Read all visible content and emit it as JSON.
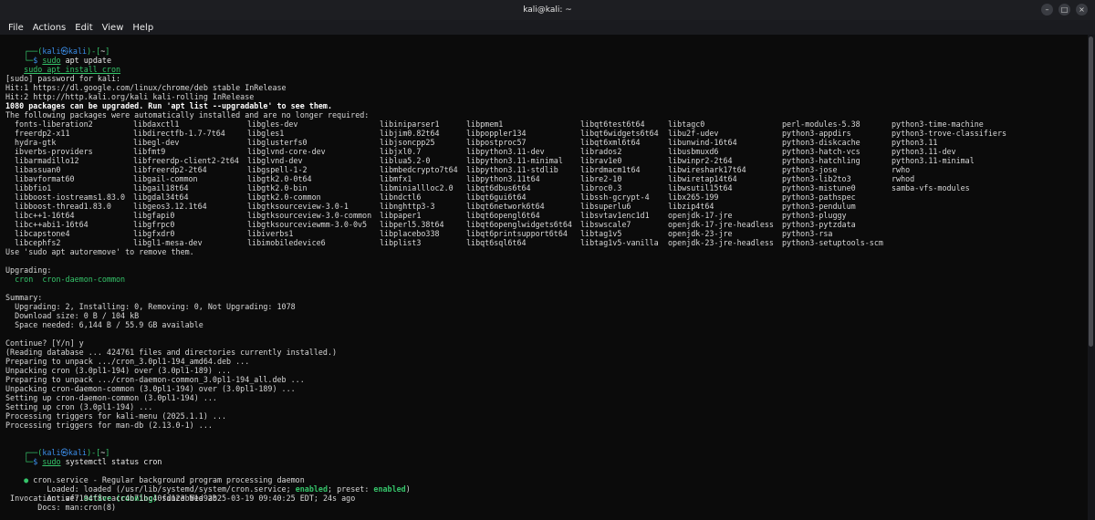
{
  "window": {
    "title": "kali@kali: ~",
    "controls": [
      "minimize",
      "maximize",
      "close"
    ]
  },
  "menu": [
    "File",
    "Actions",
    "Edit",
    "View",
    "Help"
  ],
  "prompt": {
    "user": "kali",
    "at": "㉿",
    "host": "kali",
    "cwd": "~"
  },
  "commands": {
    "update_sudo": "sudo",
    "update_rest": " apt update",
    "install": "sudo apt install cron",
    "status_sudo": "sudo",
    "status_rest": " systemctl status cron"
  },
  "output_top": [
    "[sudo] password for kali:",
    "Hit:1 https://dl.google.com/linux/chrome/deb stable InRelease",
    "Hit:2 http://http.kali.org/kali kali-rolling InRelease",
    "1080 packages can be upgraded. Run 'apt list --upgradable' to see them.",
    "The following packages were automatically installed and are no longer required:"
  ],
  "package_columns": [
    [
      "fonts-liberation2",
      "freerdp2-x11",
      "hydra-gtk",
      "ibverbs-providers",
      "libarmadillo12",
      "libassuan0",
      "libavformat60",
      "libbfio1",
      "libboost-iostreams1.83.0",
      "libboost-thread1.83.0",
      "libc++1-16t64",
      "libc++abi1-16t64",
      "libcapstone4",
      "libcephfs2"
    ],
    [
      "libdaxctl1",
      "libdirectfb-1.7-7t64",
      "libegl-dev",
      "libfmt9",
      "libfreerdp-client2-2t64",
      "libfreerdp2-2t64",
      "libgail-common",
      "libgail18t64",
      "libgdal34t64",
      "libgeos3.12.1t64",
      "libgfapi0",
      "libgfrpc0",
      "libgfxdr0",
      "libgl1-mesa-dev"
    ],
    [
      "libgles-dev",
      "libgles1",
      "libglusterfs0",
      "libglvnd-core-dev",
      "libglvnd-dev",
      "libgspell-1-2",
      "libgtk2.0-0t64",
      "libgtk2.0-bin",
      "libgtk2.0-common",
      "libgtksourceview-3.0-1",
      "libgtksourceview-3.0-common",
      "libgtksourceviewmm-3.0-0v5",
      "libiverbs1",
      "libimobiledevice6"
    ],
    [
      "libiniparser1",
      "libjim0.82t64",
      "libjsoncpp25",
      "libjxl0.7",
      "liblua5.2-0",
      "libmbedcrypto7t64",
      "libmfx1",
      "libminiallloc2.0",
      "libndctl6",
      "libnghttp3-3",
      "libpaper1",
      "libperl5.38t64",
      "libplacebo338",
      "libplist3"
    ],
    [
      "libpmem1",
      "libpoppler134",
      "libpostproc57",
      "libpython3.11-dev",
      "libpython3.11-minimal",
      "libpython3.11-stdlib",
      "libpython3.11t64",
      "libqt6dbus6t64",
      "libqt6gui6t64",
      "libqt6network6t64",
      "libqt6opengl6t64",
      "libqt6openglwidgets6t64",
      "libqt6printsupport6t64",
      "libqt6sql6t64"
    ],
    [
      "libqt6test6t64",
      "libqt6widgets6t64",
      "libqt6xml6t64",
      "librados2",
      "librav1e0",
      "librdmacm1t64",
      "libre2-10",
      "libroc0.3",
      "libssh-gcrypt-4",
      "libsuperlu6",
      "libsvtav1enc1d1",
      "libswscale7",
      "libtag1v5",
      "libtag1v5-vanilla"
    ],
    [
      "libtagc0",
      "libu2f-udev",
      "libunwind-16t64",
      "libusbmuxd6",
      "libwinpr2-2t64",
      "libwireshark17t64",
      "libwiretap14t64",
      "libwsutil15t64",
      "libx265-199",
      "libzip4t64",
      "openjdk-17-jre",
      "openjdk-17-jre-headless",
      "openjdk-23-jre",
      "openjdk-23-jre-headless"
    ],
    [
      "perl-modules-5.38",
      "python3-appdirs",
      "python3-diskcache",
      "python3-hatch-vcs",
      "python3-hatchling",
      "python3-jose",
      "python3-lib2to3",
      "python3-mistune0",
      "python3-pathspec",
      "python3-pendulum",
      "python3-pluggy",
      "python3-pytzdata",
      "python3-rsa",
      "python3-setuptools-scm"
    ],
    [
      "python3-time-machine",
      "python3-trove-classifiers",
      "python3.11",
      "python3.11-dev",
      "python3.11-minimal",
      "rwho",
      "rwhod",
      "samba-vfs-modules"
    ]
  ],
  "output_mid": [
    "Use 'sudo apt autoremove' to remove them.",
    "",
    "Upgrading:",
    "  cron  cron-daemon-common",
    "",
    "Summary:",
    "  Upgrading: 2, Installing: 0, Removing: 0, Not Upgrading: 1078",
    "  Download size: 0 B / 104 kB",
    "  Space needed: 6,144 B / 55.9 GB available",
    "",
    "Continue? [Y/n] y",
    "(Reading database ... 424761 files and directories currently installed.)",
    "Preparing to unpack .../cron_3.0pl1-194_amd64.deb ...",
    "Unpacking cron (3.0pl1-194) over (3.0pl1-189) ...",
    "Preparing to unpack .../cron-daemon-common_3.0pl1-194_all.deb ...",
    "Unpacking cron-daemon-common (3.0pl1-194) over (3.0pl1-189) ...",
    "Setting up cron-daemon-common (3.0pl1-194) ...",
    "Setting up cron (3.0pl1-194) ...",
    "Processing triggers for kali-menu (2025.1.1) ...",
    "Processing triggers for man-db (2.13.0-1) ..."
  ],
  "status": {
    "bullet": "●",
    "header": " cron.service - Regular background program processing daemon",
    "loaded_label": "     Loaded: ",
    "loaded_value": "loaded (/usr/lib/systemd/system/cron.service; ",
    "enabled": "enabled",
    "preset_text": "; preset: ",
    "preset_enabled": "enabled",
    "close_paren": ")",
    "active_label": "     Active: ",
    "active_value": "active (running)",
    "active_rest": " since Wed 2025-03-19 09:40:25 EDT; 24s ago",
    "invocation": " Invocation: af7194f8ccacc4b71bc40fd123b51a9ab",
    "docs": "       Docs: man:cron(8)"
  }
}
